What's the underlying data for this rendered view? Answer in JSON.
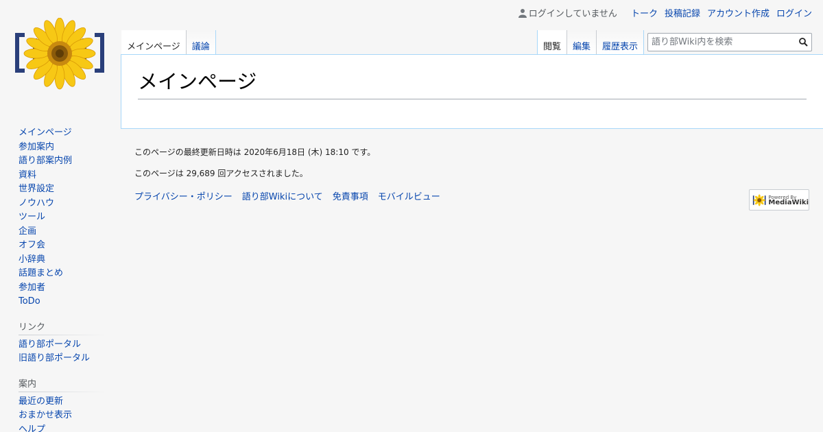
{
  "personal": {
    "anon_label": "ログインしていません",
    "links": [
      "トーク",
      "投稿記録",
      "アカウント作成",
      "ログイン"
    ]
  },
  "tabs_left": [
    "メインページ",
    "議論"
  ],
  "tabs_right": [
    "閲覧",
    "編集",
    "履歴表示"
  ],
  "search": {
    "placeholder": "語り部Wiki内を検索"
  },
  "page": {
    "title": "メインページ"
  },
  "sidebar": {
    "nav_items": [
      "メインページ",
      "参加案内",
      "語り部案内例",
      "資料",
      "世界設定",
      "ノウハウ",
      "ツール",
      "企画",
      "オフ会",
      "小辞典",
      "話題まとめ",
      "参加者",
      "ToDo"
    ],
    "portals": [
      {
        "heading": "リンク",
        "items": [
          "語り部ポータル",
          "旧語り部ポータル"
        ]
      },
      {
        "heading": "案内",
        "items": [
          "最近の更新",
          "おまかせ表示",
          "ヘルプ"
        ]
      }
    ]
  },
  "footer": {
    "last_modified": "このページの最終更新日時は 2020年6月18日 (木) 18:10 です。",
    "view_count": "このページは 29,689 回アクセスされました。",
    "places": [
      "プライバシー・ポリシー",
      "語り部Wikiについて",
      "免責事項",
      "モバイルビュー"
    ],
    "powered_small": "Powered By",
    "powered_main": "MediaWiki"
  },
  "colors": {
    "link": "#0645ad",
    "content_border": "#a7d7f9",
    "background": "#f6f6f6"
  }
}
